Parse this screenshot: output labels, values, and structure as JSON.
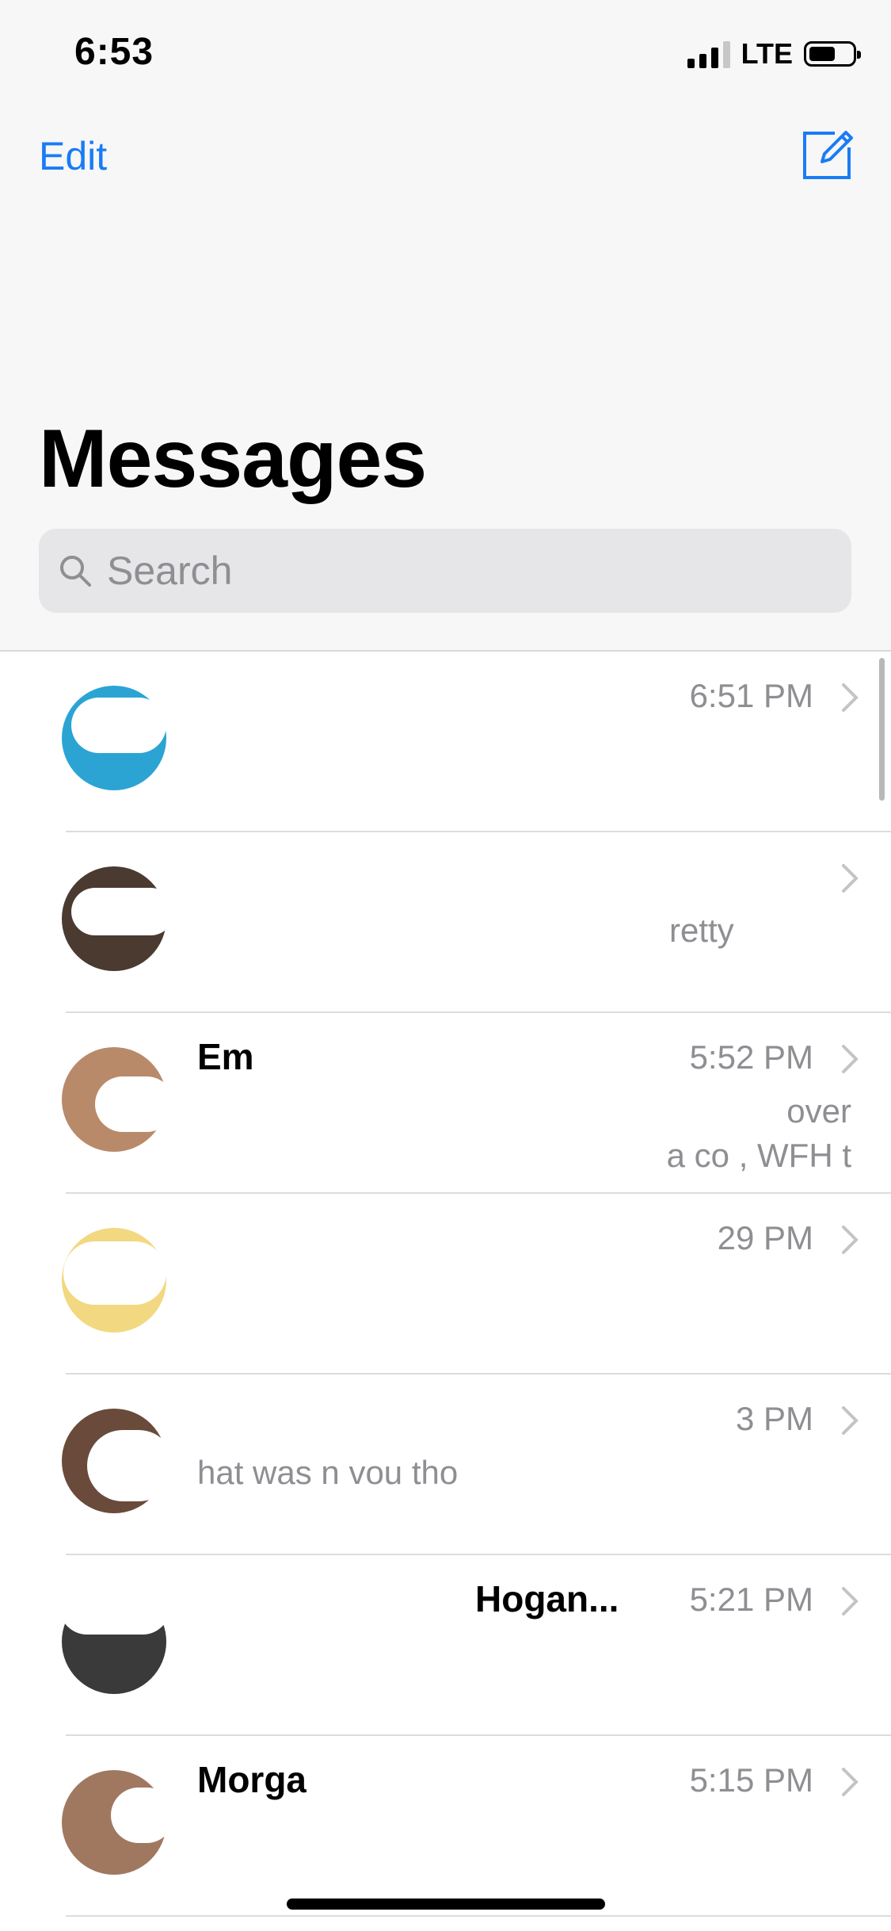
{
  "status_bar": {
    "time": "6:53",
    "network": "LTE"
  },
  "header": {
    "edit_label": "Edit",
    "title": "Messages"
  },
  "search": {
    "placeholder": "Search"
  },
  "conversations": [
    {
      "name": "",
      "time": "6:51 PM",
      "preview": ""
    },
    {
      "name": "",
      "time": "",
      "preview": "retty"
    },
    {
      "name": "Em",
      "time": "5:52 PM",
      "preview": "over\na co , WFH t"
    },
    {
      "name": "",
      "time": "29 PM",
      "preview": ""
    },
    {
      "name": "",
      "time": "3 PM",
      "preview": "hat was n vou tho"
    },
    {
      "name": "Hogan...",
      "time": "5:21 PM",
      "preview": ""
    },
    {
      "name": "Morga",
      "time": "5:15 PM",
      "preview": ""
    }
  ],
  "colors": {
    "accent": "#1a7cf5",
    "secondary_text": "#8e8e93"
  },
  "icons": [
    "compose-icon",
    "search-icon",
    "chevron-right-icon"
  ]
}
